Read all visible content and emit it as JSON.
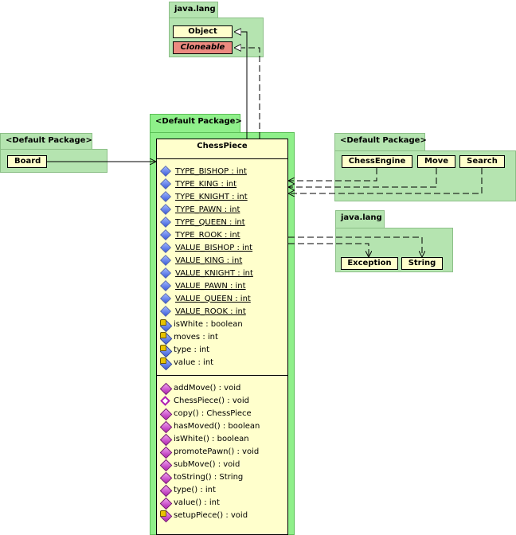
{
  "packages": {
    "java_lang_top": {
      "name": "java.lang",
      "classes": {
        "object": "Object",
        "cloneable": "Cloneable"
      }
    },
    "default_center": {
      "name": "<Default Package>"
    },
    "default_left": {
      "name": "<Default Package>",
      "classes": {
        "board": "Board"
      }
    },
    "default_right": {
      "name": "<Default Package>",
      "classes": {
        "chess_engine": "ChessEngine",
        "move": "Move",
        "search": "Search"
      }
    },
    "java_lang_right": {
      "name": "java.lang",
      "classes": {
        "exception": "Exception",
        "string": "String"
      }
    }
  },
  "chess_piece": {
    "name": "ChessPiece",
    "attributes": [
      {
        "text": "TYPE_BISHOP : int",
        "icon": "static-field-icon"
      },
      {
        "text": "TYPE_KING : int",
        "icon": "static-field-icon"
      },
      {
        "text": "TYPE_KNIGHT : int",
        "icon": "static-field-icon"
      },
      {
        "text": "TYPE_PAWN : int",
        "icon": "static-field-icon"
      },
      {
        "text": "TYPE_QUEEN : int",
        "icon": "static-field-icon"
      },
      {
        "text": "TYPE_ROOK : int",
        "icon": "static-field-icon"
      },
      {
        "text": "VALUE_BISHOP : int",
        "icon": "static-field-icon"
      },
      {
        "text": "VALUE_KING : int",
        "icon": "static-field-icon"
      },
      {
        "text": "VALUE_KNIGHT : int",
        "icon": "static-field-icon"
      },
      {
        "text": "VALUE_PAWN : int",
        "icon": "static-field-icon"
      },
      {
        "text": "VALUE_QUEEN : int",
        "icon": "static-field-icon"
      },
      {
        "text": "VALUE_ROOK : int",
        "icon": "static-field-icon"
      },
      {
        "text": "isWhite : boolean",
        "icon": "private-field-icon"
      },
      {
        "text": "moves : int",
        "icon": "private-field-icon"
      },
      {
        "text": "type : int",
        "icon": "private-field-icon"
      },
      {
        "text": "value : int",
        "icon": "private-field-icon"
      }
    ],
    "operations": [
      {
        "text": "addMove() : void",
        "icon": "method-icon"
      },
      {
        "text": "ChessPiece() : void",
        "icon": "constructor-icon"
      },
      {
        "text": "copy() : ChessPiece",
        "icon": "method-icon"
      },
      {
        "text": "hasMoved() : boolean",
        "icon": "method-icon"
      },
      {
        "text": "isWhite() : boolean",
        "icon": "method-icon"
      },
      {
        "text": "promotePawn() : void",
        "icon": "method-icon"
      },
      {
        "text": "subMove() : void",
        "icon": "method-icon"
      },
      {
        "text": "toString() : String",
        "icon": "method-icon"
      },
      {
        "text": "type() : int",
        "icon": "method-icon"
      },
      {
        "text": "value() : int",
        "icon": "method-icon"
      },
      {
        "text": "setupPiece() : void",
        "icon": "private-method-icon"
      }
    ]
  },
  "colors": {
    "package_fill": "#b5e4b0",
    "package_fill_bright": "#8ff08a",
    "class_fill": "#ffffcc",
    "interface_fill": "#ec8a80"
  }
}
